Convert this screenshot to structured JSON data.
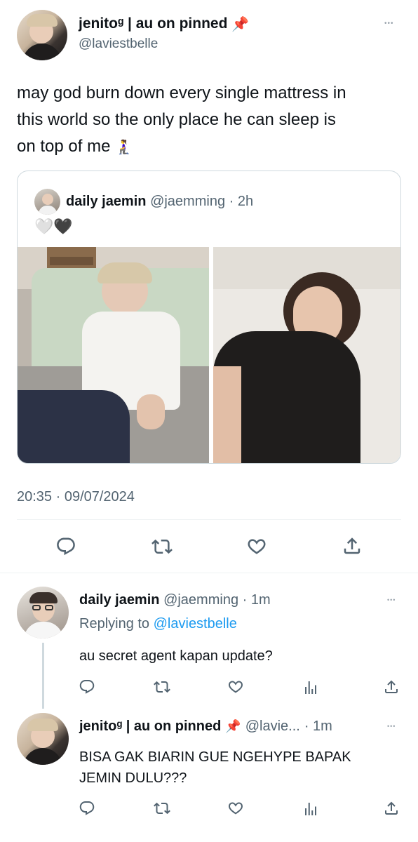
{
  "main_tweet": {
    "display_name": "jenitoᶢ | au on pinned",
    "handle": "@laviestbelle",
    "pin_emoji": "📌",
    "text": "may god burn down every single mattress in this world so the only place he can sleep is on top of me",
    "text_line1": "may god burn down every single mattress in",
    "text_line2": "this world so the only place he can sleep is",
    "text_line3": "on top of me",
    "text_emoji": "🧎‍♀️",
    "timestamp": "20:35 · 09/07/2024"
  },
  "quoted_tweet": {
    "display_name": "daily jaemin",
    "handle": "@jaemming",
    "time": "· 2h",
    "text": "🤍🖤"
  },
  "replies": [
    {
      "display_name": "daily jaemin",
      "handle": "@jaemming",
      "time": "· 1m",
      "replying_prefix": "Replying to",
      "replying_to": "@laviestbelle",
      "text": "au secret agent kapan update?"
    },
    {
      "display_name": "jenitoᶢ | au on pinned",
      "pin_emoji": "📌",
      "handle": "@lavie...",
      "time": "· 1m",
      "text_line1": "BISA GAK BIARIN GUE NGEHYPE BAPAK",
      "text_line2": "JEMIN DULU???"
    }
  ],
  "icons": {
    "reply": "reply-icon",
    "retweet": "retweet-icon",
    "like": "like-icon",
    "share": "share-icon",
    "views": "views-icon",
    "more": "more-icon"
  },
  "colors": {
    "text": "#0f1419",
    "muted": "#536471",
    "link": "#1d9bf0",
    "divider": "#eff3f4",
    "thread_line": "#cfd9de",
    "pin": "#e0245e"
  },
  "more_glyph": "•••"
}
